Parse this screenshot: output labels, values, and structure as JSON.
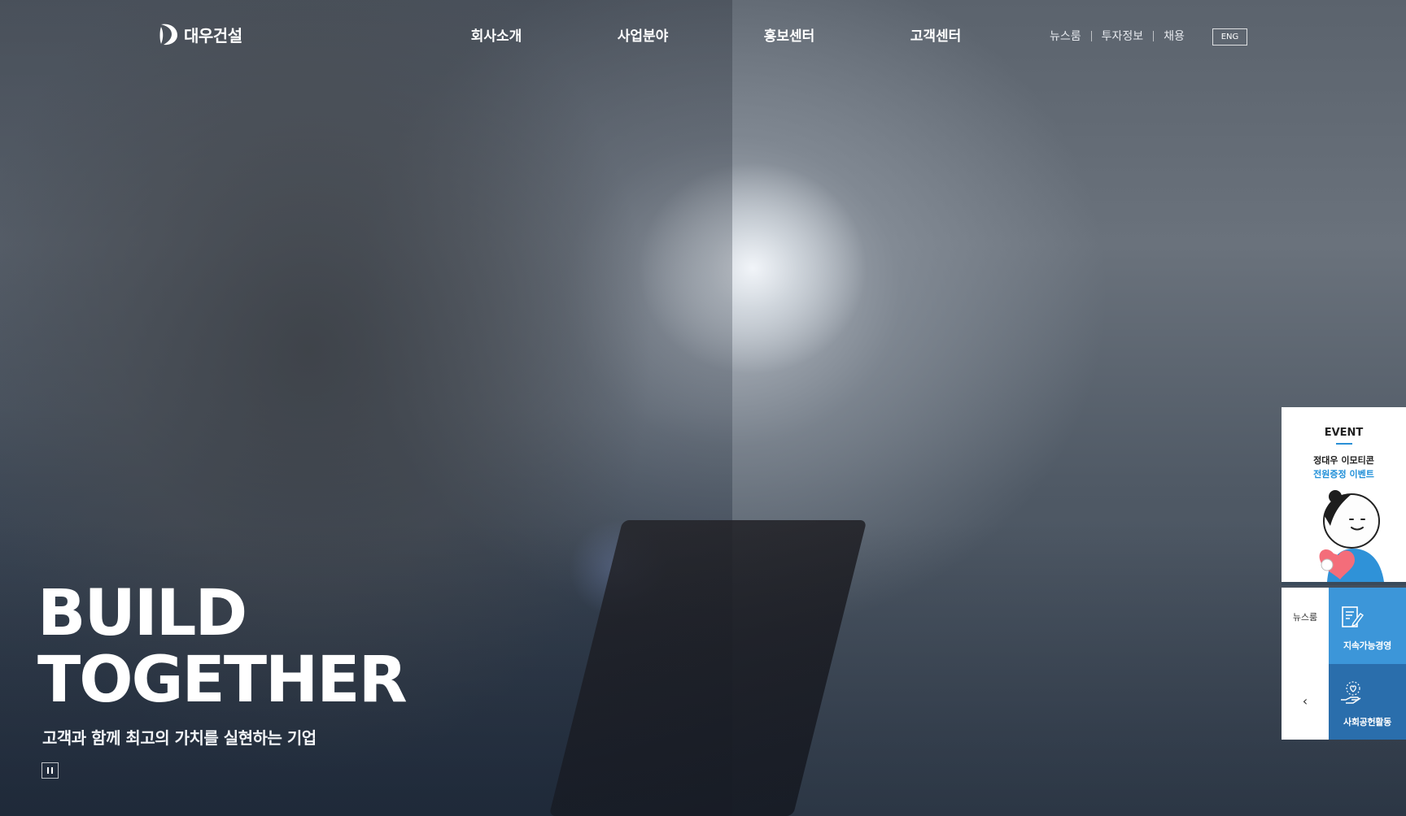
{
  "brand": {
    "name": "대우건설",
    "logo_icon": "daewoo-d-mark"
  },
  "nav": {
    "items": [
      {
        "label": "회사소개"
      },
      {
        "label": "사업분야"
      },
      {
        "label": "홍보센터"
      },
      {
        "label": "고객센터"
      }
    ]
  },
  "util": {
    "links": [
      {
        "label": "뉴스룸"
      },
      {
        "label": "투자정보"
      },
      {
        "label": "채용"
      }
    ],
    "lang": "ENG"
  },
  "hero": {
    "title_line1": "BUILD",
    "title_line2": "TOGETHER",
    "subtitle": "고객과 함께 최고의 가치를 실현하는 기업",
    "pause_icon": "pause-icon"
  },
  "quick": {
    "event_title": "EVENT",
    "event_line1": "정대우 이모티콘",
    "event_line2": "전원증정 이벤트",
    "newsroom_label": "뉴스룸",
    "collapse_arrow": "‹",
    "sustain_label": "지속가능경영",
    "social_label": "사회공헌활동"
  },
  "colors": {
    "accent_blue": "#3c96d9",
    "dark_blue": "#2a6eac",
    "event_blue": "#1f8fd8"
  }
}
